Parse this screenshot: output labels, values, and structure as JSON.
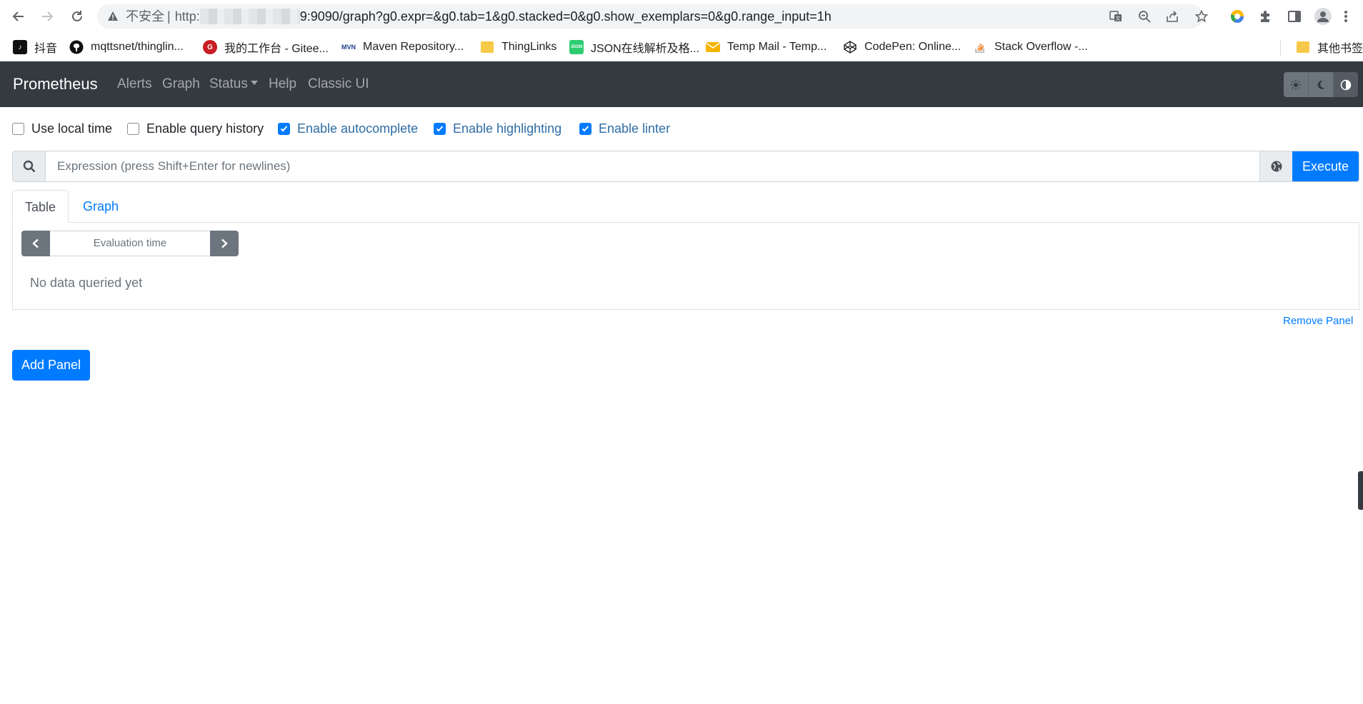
{
  "browser": {
    "security_label": "不安全",
    "url_scheme": "http:",
    "url_rest": "9:9090/graph?g0.expr=&g0.tab=1&g0.stacked=0&g0.show_exemplars=0&g0.range_input=1h"
  },
  "bookmarks": [
    {
      "label": "抖音",
      "icon": "tiktok-icon"
    },
    {
      "label": "mqttsnet/thinglin...",
      "icon": "github-icon"
    },
    {
      "label": "我的工作台 - Gitee...",
      "icon": "gitee-icon"
    },
    {
      "label": "Maven Repository...",
      "icon": "mvn-icon",
      "icon_text": "MVN"
    },
    {
      "label": "ThingLinks",
      "icon": "folder-icon"
    },
    {
      "label": "JSON在线解析及格...",
      "icon": "json-icon",
      "icon_text": "JSON"
    },
    {
      "label": "Temp Mail - Temp...",
      "icon": "mail-icon"
    },
    {
      "label": "CodePen: Online...",
      "icon": "codepen-icon"
    },
    {
      "label": "Stack Overflow -...",
      "icon": "stackoverflow-icon"
    }
  ],
  "other_bookmarks": "其他书签",
  "navbar": {
    "brand": "Prometheus",
    "links": [
      "Alerts",
      "Graph",
      "Status",
      "Help",
      "Classic UI"
    ]
  },
  "options": [
    {
      "label": "Use local time",
      "checked": false
    },
    {
      "label": "Enable query history",
      "checked": false
    },
    {
      "label": "Enable autocomplete",
      "checked": true
    },
    {
      "label": "Enable highlighting",
      "checked": true
    },
    {
      "label": "Enable linter",
      "checked": true
    }
  ],
  "expression": {
    "placeholder": "Expression (press Shift+Enter for newlines)",
    "value": "",
    "execute_label": "Execute"
  },
  "tabs": {
    "table": "Table",
    "graph": "Graph"
  },
  "panel": {
    "evaluation_time_placeholder": "Evaluation time",
    "empty_message": "No data queried yet",
    "remove_label": "Remove Panel"
  },
  "add_panel_label": "Add Panel",
  "colors": {
    "navbar_bg": "#343a40",
    "primary": "#007bff",
    "secondary": "#6c757d"
  }
}
